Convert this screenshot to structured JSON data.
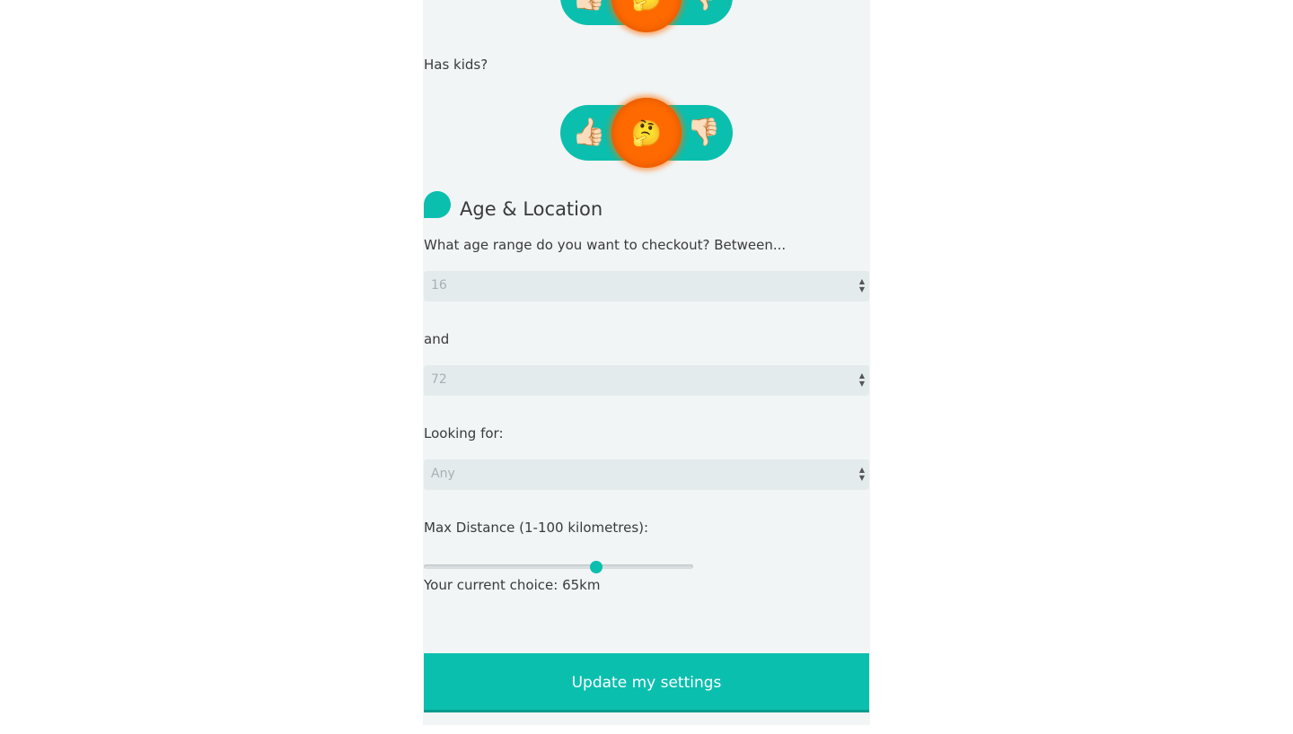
{
  "top_toggle": {
    "yes_icon": "👍🏻",
    "maybe_icon": "🤔",
    "no_icon": "👎🏻"
  },
  "kids": {
    "label": "Has kids?",
    "yes_icon": "👍🏻",
    "maybe_icon": "🤔",
    "no_icon": "👎🏻"
  },
  "section": {
    "title": "Age & Location"
  },
  "age": {
    "question": "What age range do you want to checkout? Between...",
    "min_value": "16",
    "and_label": "and",
    "max_value": "72"
  },
  "looking_for": {
    "label": "Looking for:",
    "value": "Any"
  },
  "distance": {
    "label": "Max Distance (1-100 kilometres):",
    "min": 1,
    "max": 100,
    "value": 65,
    "current_text": "Your current choice: 65km"
  },
  "submit_label": "Update my settings",
  "colors": {
    "accent": "#0bbfae",
    "knob": "#ff6a00",
    "panel": "#f1f5f6"
  }
}
